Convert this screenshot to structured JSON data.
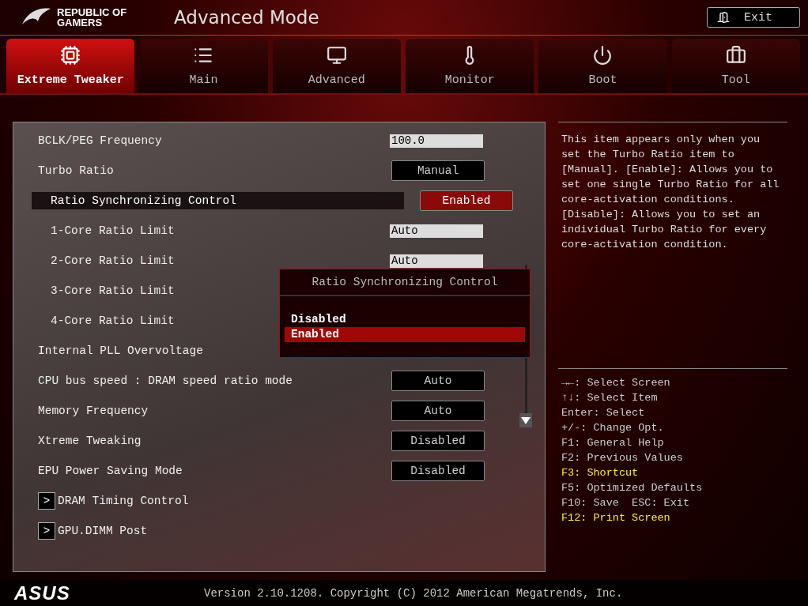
{
  "header": {
    "brand": "REPUBLIC OF GAMERS",
    "title": "Advanced Mode",
    "exit_button": "Exit"
  },
  "tabs": [
    {
      "label": "Extreme Tweaker",
      "selected": true
    },
    {
      "label": "Main",
      "selected": false
    },
    {
      "label": "Advanced",
      "selected": false
    },
    {
      "label": "Monitor",
      "selected": false
    },
    {
      "label": "Boot",
      "selected": false
    },
    {
      "label": "Tool",
      "selected": false
    }
  ],
  "settings": [
    {
      "kind": "input",
      "label": "BCLK/PEG Frequency",
      "value": "100.0",
      "selected": false
    },
    {
      "kind": "select",
      "label": "Turbo Ratio",
      "value": "Manual",
      "selected": false,
      "children": [
        {
          "kind": "select",
          "label": "Ratio Synchronizing Control",
          "value": "Enabled",
          "selected": true
        },
        {
          "kind": "input",
          "label": "1-Core Ratio Limit",
          "value": "Auto",
          "selected": false
        },
        {
          "kind": "input",
          "label": "2-Core Ratio Limit",
          "value": "Auto",
          "selected": false
        },
        {
          "kind": "input",
          "label": "3-Core Ratio Limit",
          "selected": false
        },
        {
          "kind": "input",
          "label": "4-Core Ratio Limit",
          "selected": false
        }
      ]
    },
    {
      "kind": "select",
      "label": "Internal PLL Overvoltage",
      "selected": false
    },
    {
      "kind": "select",
      "label": "CPU bus speed : DRAM speed ratio mode",
      "value": "Auto",
      "selected": false
    },
    {
      "kind": "select",
      "label": "Memory Frequency",
      "value": "Auto",
      "selected": false
    },
    {
      "kind": "select",
      "label": "Xtreme Tweaking",
      "value": "Disabled",
      "selected": false
    },
    {
      "kind": "select",
      "label": "EPU Power Saving Mode",
      "value": "Disabled",
      "selected": false
    },
    {
      "kind": "submenu",
      "label": "DRAM Timing Control",
      "arrow": ">",
      "selected": false
    },
    {
      "kind": "submenu",
      "label": "GPU.DIMM Post",
      "arrow": ">",
      "selected": false
    }
  ],
  "popup": {
    "title": "Ratio Synchronizing Control",
    "options": [
      {
        "label": "Disabled",
        "selected": false
      },
      {
        "label": "Enabled",
        "selected": true
      }
    ]
  },
  "help_text": "This item appears only when you set the Turbo Ratio item to [Manual]. [Enable]: Allows you to set one single Turbo Ratio for all core-activation conditions. [Disable]: Allows you to set an individual Turbo Ratio for every core-activation condition.",
  "key_hints": [
    {
      "text": "→←: Select Screen",
      "highlighted": false
    },
    {
      "text": "↑↓: Select Item",
      "highlighted": false
    },
    {
      "text": "Enter: Select",
      "highlighted": false
    },
    {
      "text": "+/-: Change Opt.",
      "highlighted": false
    },
    {
      "text": "F1: General Help",
      "highlighted": false
    },
    {
      "text": "F2: Previous Values",
      "highlighted": false
    },
    {
      "text": "F3: Shortcut",
      "highlighted": true
    },
    {
      "text": "F5: Optimized Defaults",
      "highlighted": false
    },
    {
      "text": "F10: Save  ESC: Exit",
      "highlighted": false
    },
    {
      "text": "F12: Print Screen",
      "highlighted": true
    }
  ],
  "footer": {
    "logo": "ASUS",
    "version": "Version 2.10.1208. Copyright (C) 2012 American Megatrends, Inc."
  }
}
